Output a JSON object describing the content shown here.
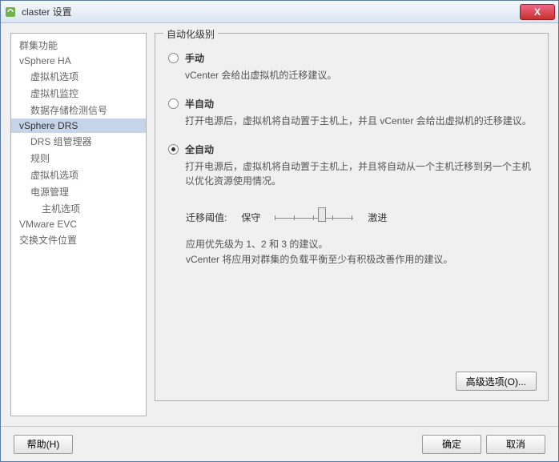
{
  "window": {
    "title": "claster 设置"
  },
  "sidebar": {
    "items": [
      {
        "label": "群集功能",
        "indent": 0
      },
      {
        "label": "vSphere HA",
        "indent": 0
      },
      {
        "label": "虚拟机选项",
        "indent": 1
      },
      {
        "label": "虚拟机监控",
        "indent": 1
      },
      {
        "label": "数据存储检测信号",
        "indent": 1
      },
      {
        "label": "vSphere DRS",
        "indent": 0,
        "selected": true
      },
      {
        "label": "DRS 组管理器",
        "indent": 1
      },
      {
        "label": "规则",
        "indent": 1
      },
      {
        "label": "虚拟机选项",
        "indent": 1
      },
      {
        "label": "电源管理",
        "indent": 1
      },
      {
        "label": "主机选项",
        "indent": 2
      },
      {
        "label": "VMware EVC",
        "indent": 0
      },
      {
        "label": "交换文件位置",
        "indent": 0
      }
    ]
  },
  "main": {
    "legend": "自动化级别",
    "options": [
      {
        "value": "manual",
        "label": "手动",
        "desc": "vCenter 会给出虚拟机的迁移建议。",
        "checked": false
      },
      {
        "value": "partial",
        "label": "半自动",
        "desc": "打开电源后，虚拟机将自动置于主机上，并且 vCenter 会给出虚拟机的迁移建议。",
        "checked": false
      },
      {
        "value": "full",
        "label": "全自动",
        "desc": "打开电源后，虚拟机将自动置于主机上，并且将自动从一个主机迁移到另一个主机以优化资源使用情况。",
        "checked": true
      }
    ],
    "slider": {
      "label": "迁移阈值:",
      "left": "保守",
      "right": "激进"
    },
    "info": {
      "line1": "应用优先级为 1、2 和 3 的建议。",
      "line2": "vCenter 将应用对群集的负载平衡至少有积极改善作用的建议。"
    },
    "advanced_button": "高级选项(O)..."
  },
  "footer": {
    "help": "帮助(H)",
    "ok": "确定",
    "cancel": "取消"
  }
}
